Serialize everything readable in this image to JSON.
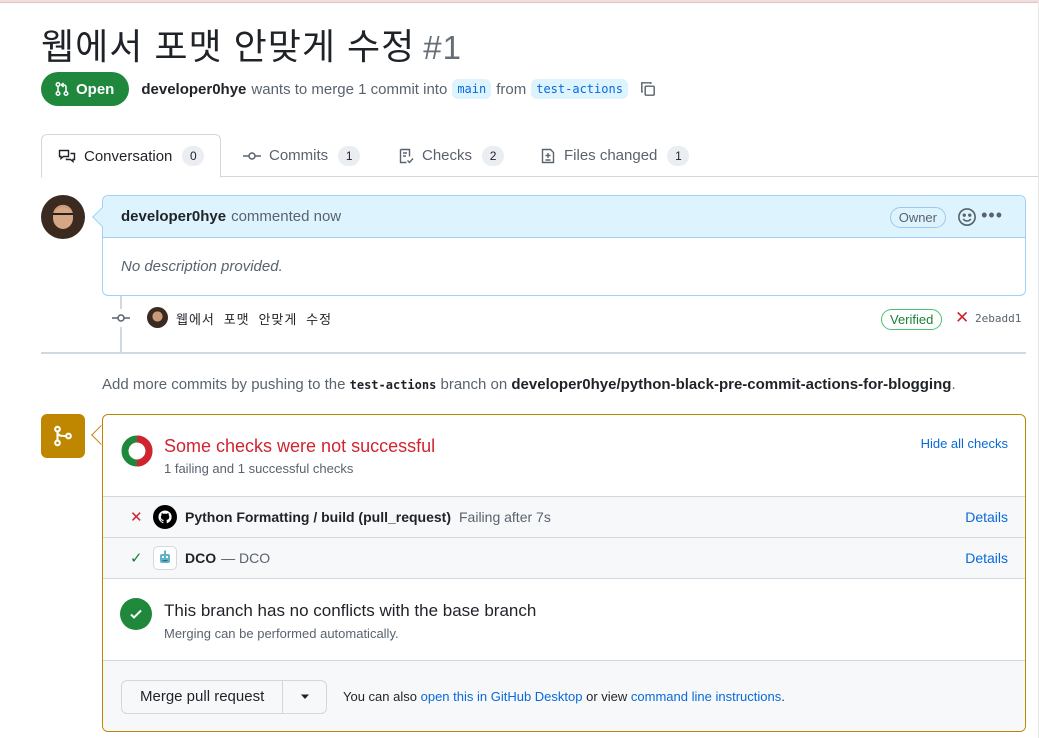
{
  "pr": {
    "title": "웹에서 포맷 안맞게 수정",
    "number": "#1",
    "state": "Open",
    "author": "developer0hye",
    "merge_text": "wants to merge 1 commit into",
    "base_branch": "main",
    "from_text": "from",
    "head_branch": "test-actions"
  },
  "tabs": [
    {
      "label": "Conversation",
      "count": "0"
    },
    {
      "label": "Commits",
      "count": "1"
    },
    {
      "label": "Checks",
      "count": "2"
    },
    {
      "label": "Files changed",
      "count": "1"
    }
  ],
  "comment": {
    "author": "developer0hye",
    "action": "commented now",
    "role": "Owner",
    "body": "No description provided."
  },
  "commit": {
    "message": "웹에서 포맷 안맞게 수정",
    "verified": "Verified",
    "sha": "2ebadd1"
  },
  "hint": {
    "prefix": "Add more commits by pushing to the",
    "branch": "test-actions",
    "middle": "branch on",
    "repo": "developer0hye/python-black-pre-commit-actions-for-blogging",
    "suffix": "."
  },
  "checks": {
    "title": "Some checks were not successful",
    "subtitle": "1 failing and 1 successful checks",
    "toggle": "Hide all checks",
    "rows": [
      {
        "status": "failure",
        "name": "Python Formatting / build (pull_request)",
        "detail": "Failing after 7s",
        "link": "Details",
        "app_icon": "github-icon"
      },
      {
        "status": "success",
        "name": "DCO",
        "detail": "— DCO",
        "link": "Details",
        "app_icon": "dco-bot-icon"
      }
    ]
  },
  "conflict": {
    "title": "This branch has no conflicts with the base branch",
    "subtitle": "Merging can be performed automatically."
  },
  "merge": {
    "button": "Merge pull request",
    "note_prefix": "You can also",
    "desktop_link": "open this in GitHub Desktop",
    "note_middle": "or view",
    "cli_link": "command line instructions",
    "note_suffix": "."
  },
  "colors": {
    "open_green": "#1f883d",
    "link_blue": "#0969da",
    "failure_red": "#d1242f",
    "pending_gold": "#bf8700",
    "comment_blue": "#ddf4ff"
  }
}
